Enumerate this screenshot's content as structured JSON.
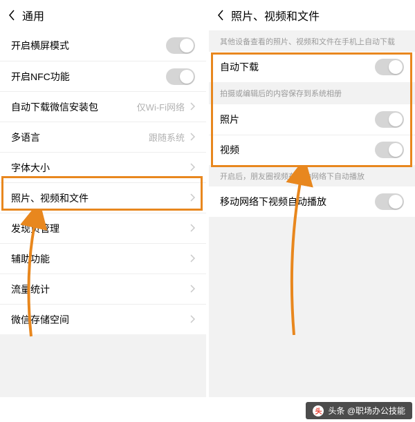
{
  "left": {
    "title": "通用",
    "rows": [
      {
        "label": "开启横屏模式",
        "type": "toggle"
      },
      {
        "label": "开启NFC功能",
        "type": "toggle"
      },
      {
        "label": "自动下载微信安装包",
        "type": "value_chev",
        "value": "仅Wi-Fi网络"
      },
      {
        "label": "多语言",
        "type": "value_chev",
        "value": "跟随系统"
      },
      {
        "label": "字体大小",
        "type": "chev"
      },
      {
        "label": "照片、视频和文件",
        "type": "chev"
      },
      {
        "label": "发现页管理",
        "type": "chev"
      },
      {
        "label": "辅助功能",
        "type": "chev"
      },
      {
        "label": "流量统计",
        "type": "chev"
      },
      {
        "label": "微信存储空间",
        "type": "chev"
      }
    ]
  },
  "right": {
    "title": "照片、视频和文件",
    "tip1": "其他设备查看的照片、视频和文件在手机上自动下载",
    "rows1": [
      {
        "label": "自动下载",
        "type": "toggle"
      }
    ],
    "tip2": "拍摄或编辑后的内容保存到系统相册",
    "rows2": [
      {
        "label": "照片",
        "type": "toggle"
      },
      {
        "label": "视频",
        "type": "toggle"
      }
    ],
    "tip3": "开启后，朋友圈视频在移动网络下自动播放",
    "rows3": [
      {
        "label": "移动网络下视频自动播放",
        "type": "toggle"
      }
    ]
  },
  "watermark": {
    "prefix": "头条",
    "text": "@职场办公技能"
  }
}
